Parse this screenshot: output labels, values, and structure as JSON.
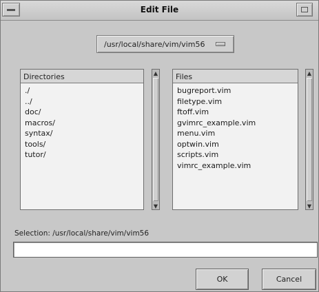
{
  "window": {
    "title": "Edit File"
  },
  "path_button": {
    "label": "/usr/local/share/vim/vim56"
  },
  "directories": {
    "header": "Directories",
    "items": [
      "./",
      "../",
      "doc/",
      "macros/",
      "syntax/",
      "tools/",
      "tutor/"
    ]
  },
  "files": {
    "header": "Files",
    "items": [
      "bugreport.vim",
      "filetype.vim",
      "ftoff.vim",
      "gvimrc_example.vim",
      "menu.vim",
      "optwin.vim",
      "scripts.vim",
      "vimrc_example.vim"
    ]
  },
  "selection": {
    "label": "Selection: /usr/local/share/vim/vim56",
    "value": ""
  },
  "buttons": {
    "ok": "OK",
    "cancel": "Cancel"
  },
  "icons": {
    "window_menu": "window-menu-icon",
    "maximize": "maximize-icon",
    "scroll_up": "scroll-up-arrow-icon",
    "scroll_down": "scroll-down-arrow-icon",
    "option_indicator": "option-menu-indicator-icon"
  }
}
